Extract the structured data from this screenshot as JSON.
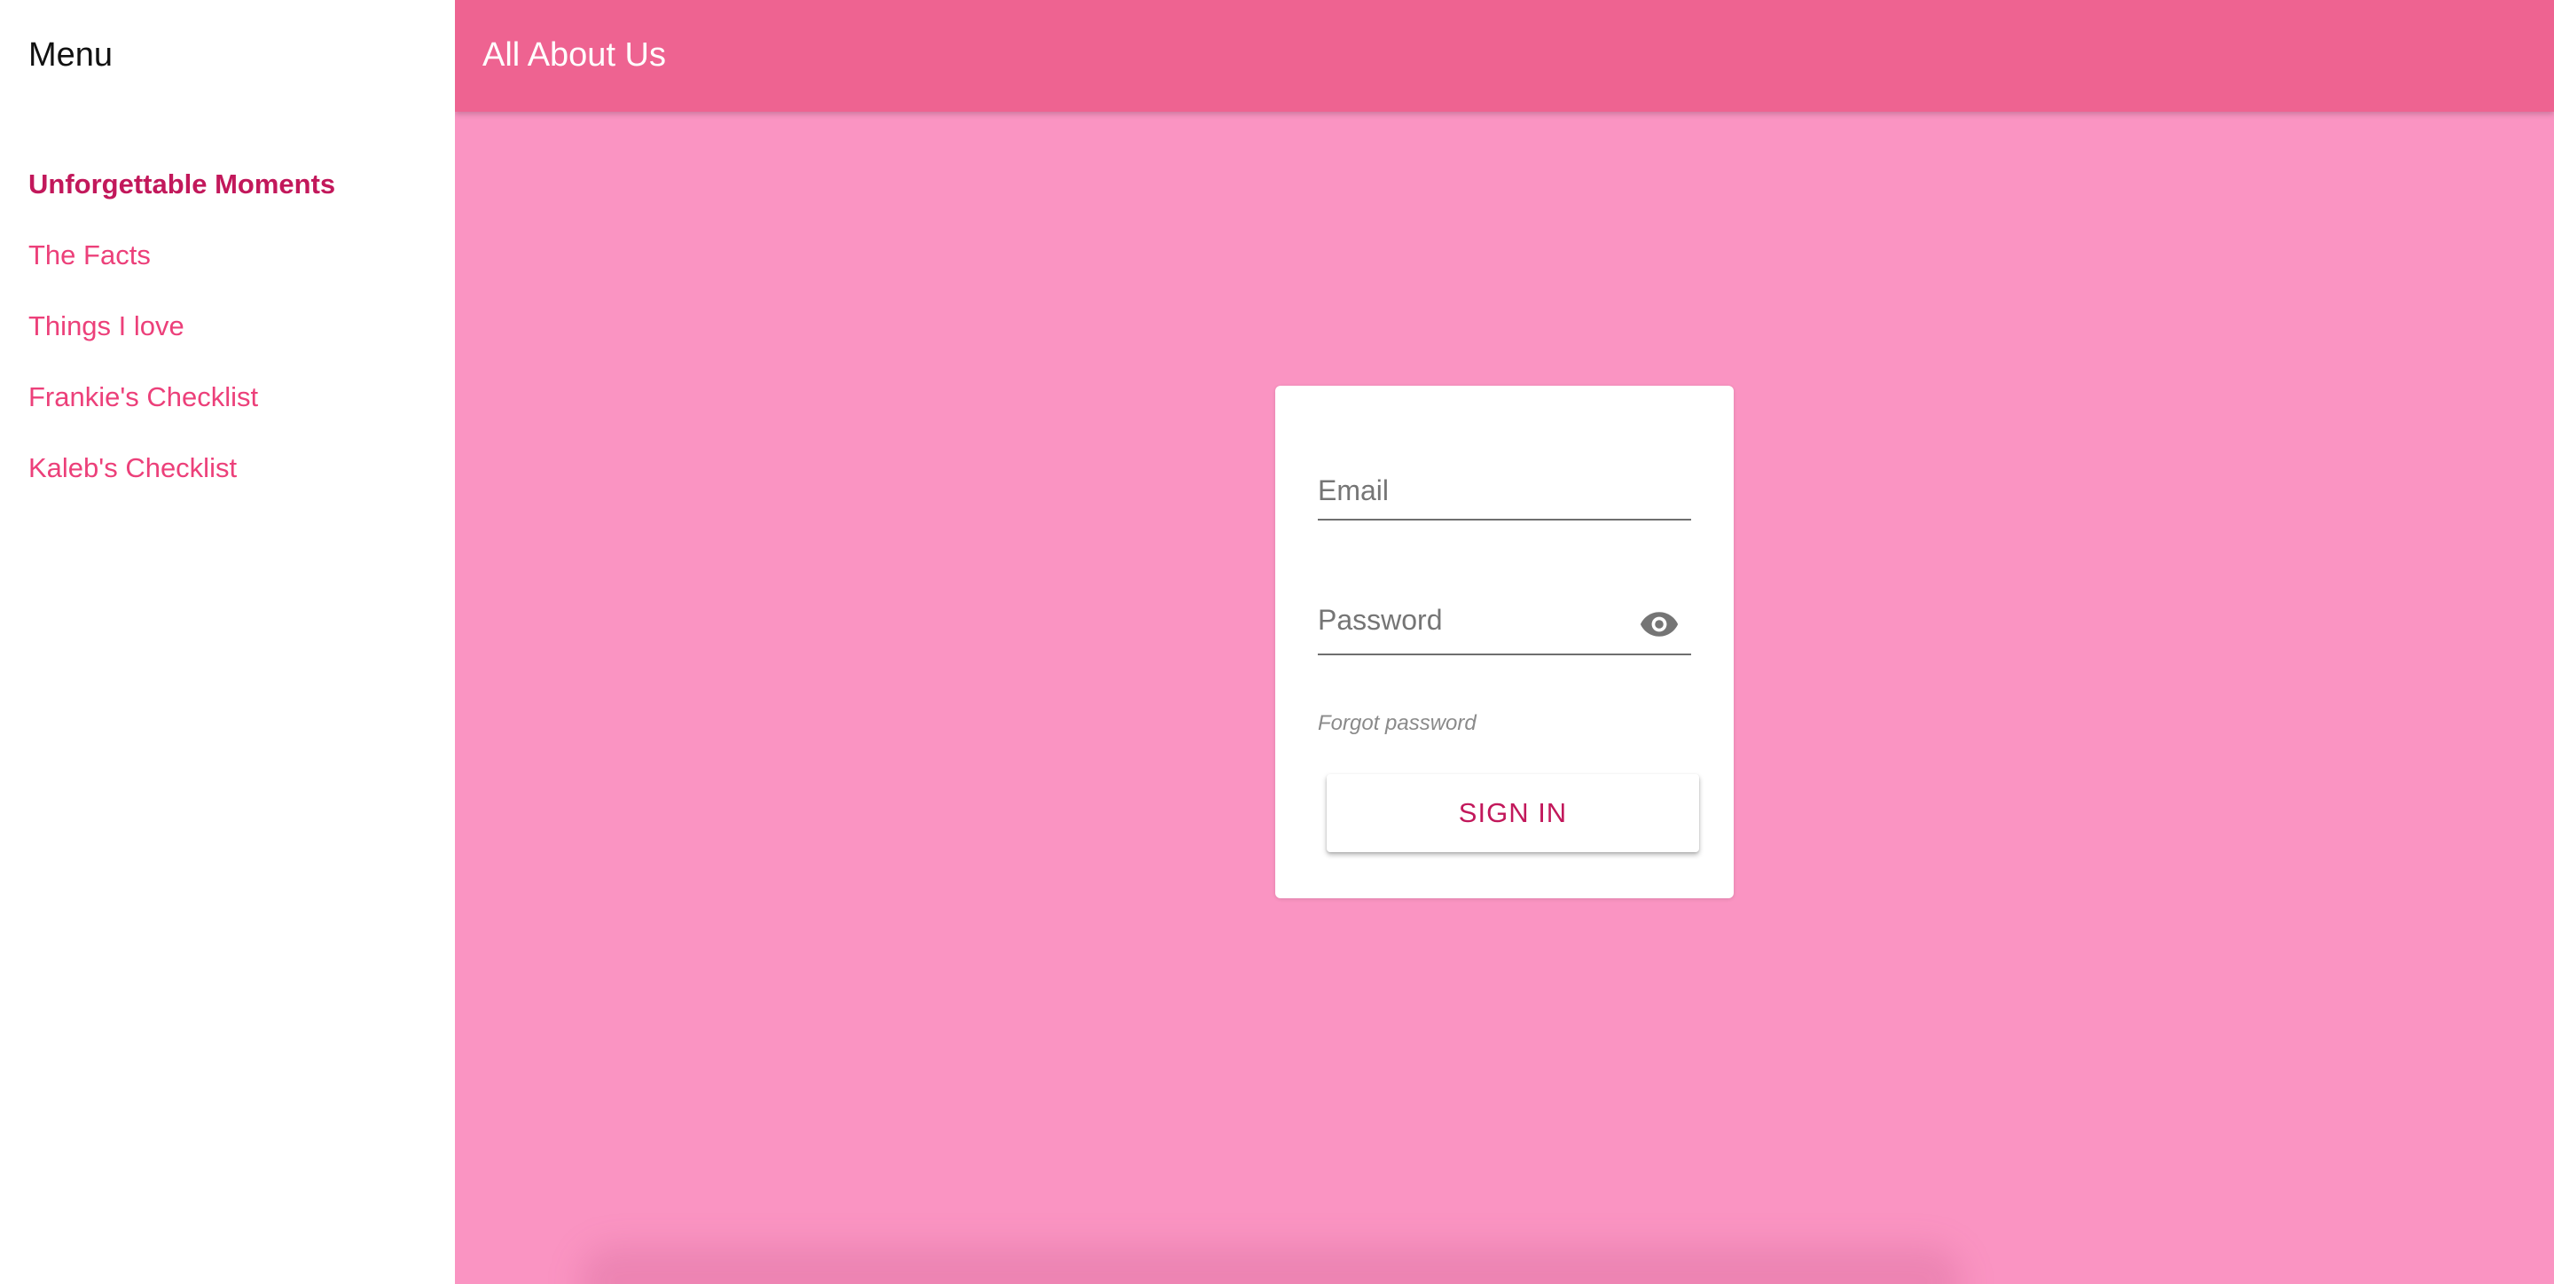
{
  "sidebar": {
    "title": "Menu",
    "items": [
      {
        "label": "Unforgettable Moments",
        "active": true
      },
      {
        "label": "The Facts",
        "active": false
      },
      {
        "label": "Things I love",
        "active": false
      },
      {
        "label": "Frankie's Checklist",
        "active": false
      },
      {
        "label": "Kaleb's Checklist",
        "active": false
      }
    ]
  },
  "header": {
    "title": "All About Us"
  },
  "login": {
    "email_placeholder": "Email",
    "email_value": "",
    "password_placeholder": "Password",
    "password_value": "",
    "visibility_icon": "eye-icon",
    "forgot_label": "Forgot password",
    "signin_label": "SIGN IN"
  },
  "colors": {
    "toolbar": "#ee6391",
    "background": "#fa94c2",
    "link": "#ec407a",
    "active_link": "#c2185b",
    "button_text": "#c2185b"
  }
}
